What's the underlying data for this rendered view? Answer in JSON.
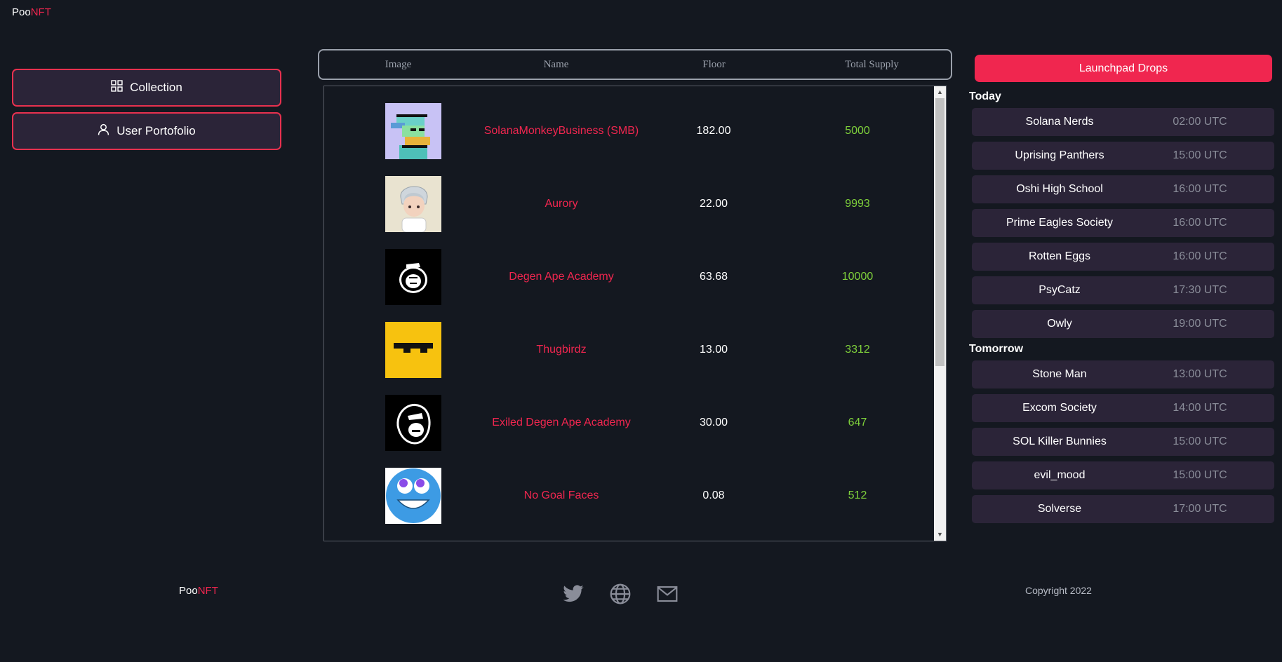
{
  "brand": {
    "prefix": "Poo",
    "suffix": "NFT"
  },
  "nav": {
    "collection_label": "Collection",
    "portfolio_label": "User Portofolio"
  },
  "table": {
    "headers": [
      "Image",
      "Name",
      "Floor",
      "Total Supply"
    ],
    "rows": [
      {
        "name": "SolanaMonkeyBusiness (SMB)",
        "floor": "182.00",
        "supply": "5000"
      },
      {
        "name": "Aurory",
        "floor": "22.00",
        "supply": "9993"
      },
      {
        "name": "Degen Ape Academy",
        "floor": "63.68",
        "supply": "10000"
      },
      {
        "name": "Thugbirdz",
        "floor": "13.00",
        "supply": "3312"
      },
      {
        "name": "Exiled Degen Ape Academy",
        "floor": "30.00",
        "supply": "647"
      },
      {
        "name": "No Goal Faces",
        "floor": "0.08",
        "supply": "512"
      }
    ]
  },
  "launchpad": {
    "button_label": "Launchpad Drops",
    "today_label": "Today",
    "tomorrow_label": "Tomorrow",
    "today": [
      {
        "name": "Solana Nerds",
        "time": "02:00 UTC"
      },
      {
        "name": "Uprising Panthers",
        "time": "15:00 UTC"
      },
      {
        "name": "Oshi High School",
        "time": "16:00 UTC"
      },
      {
        "name": "Prime Eagles Society",
        "time": "16:00 UTC"
      },
      {
        "name": "Rotten Eggs",
        "time": "16:00 UTC"
      },
      {
        "name": "PsyCatz",
        "time": "17:30 UTC"
      },
      {
        "name": "Owly",
        "time": "19:00 UTC"
      }
    ],
    "tomorrow": [
      {
        "name": "Stone Man",
        "time": "13:00 UTC"
      },
      {
        "name": "Excom Society",
        "time": "14:00 UTC"
      },
      {
        "name": "SOL Killer Bunnies",
        "time": "15:00 UTC"
      },
      {
        "name": "evil_mood",
        "time": "15:00 UTC"
      },
      {
        "name": "Solverse",
        "time": "17:00 UTC"
      }
    ]
  },
  "footer": {
    "copyright": "Copyright 2022"
  },
  "colors": {
    "accent": "#f0264f",
    "supply_green": "#7fd13b",
    "background": "#141820",
    "card": "#2b2438"
  }
}
